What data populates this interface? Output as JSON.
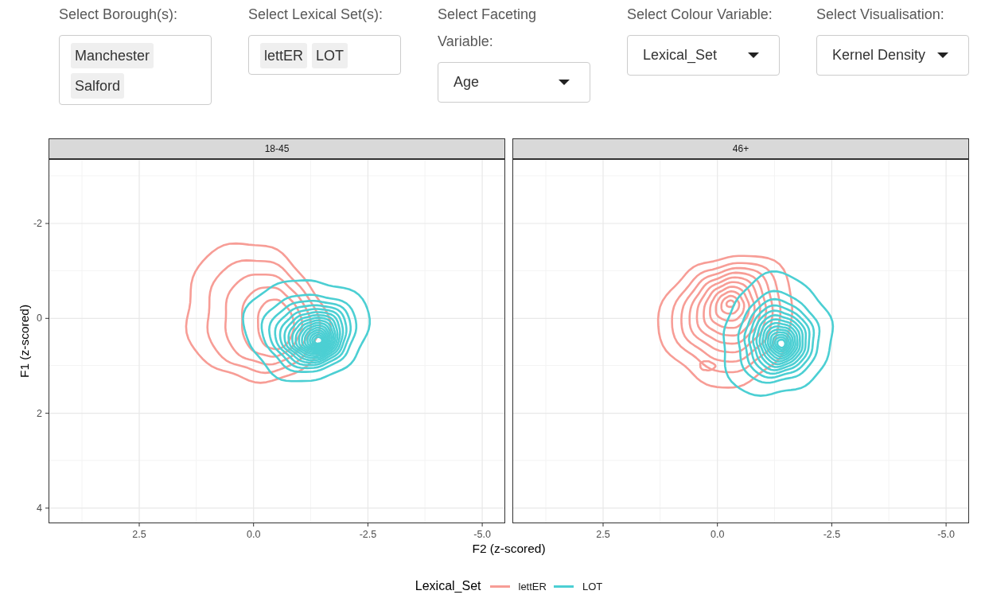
{
  "controls": [
    {
      "kind": "multiselect",
      "label": "Select Borough(s):",
      "tags": [
        "Manchester",
        "Salford"
      ]
    },
    {
      "kind": "multiselect",
      "label": "Select Lexical Set(s):",
      "tags": [
        "lettER",
        "LOT"
      ]
    },
    {
      "kind": "dropdown",
      "label": "Select Faceting Variable:",
      "value": "Age"
    },
    {
      "kind": "dropdown",
      "label": "Select Colour Variable:",
      "value": "Lexical_Set"
    },
    {
      "kind": "dropdown",
      "label": "Select Visualisation:",
      "value": "Kernel Density"
    }
  ],
  "plot": {
    "facets": [
      {
        "label": "18-45",
        "xticks": [
          "2.5",
          "0.0",
          "-2.5",
          "-5.0"
        ]
      },
      {
        "label": "46+",
        "xticks": [
          "2.5",
          "0.0",
          "-2.5",
          "-5.0"
        ]
      }
    ],
    "yticks": [
      "-2",
      "0",
      "2",
      "4"
    ],
    "xlabel": "F2 (z-scored)",
    "ylabel": "F1 (z-scored)",
    "legend": {
      "title": "Lexical_Set",
      "items": [
        {
          "label": "lettER",
          "color": "#f79d96"
        },
        {
          "label": "LOT",
          "color": "#4ccfd3"
        }
      ]
    }
  }
}
